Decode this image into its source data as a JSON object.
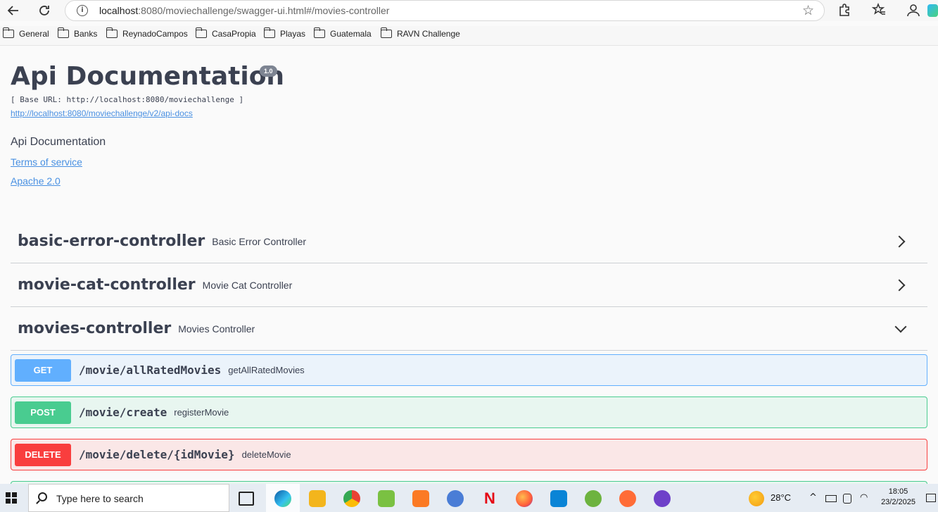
{
  "browser": {
    "url_host": "localhost",
    "url_rest": ":8080/moviechallenge/swagger-ui.html#/movies-controller",
    "back_icon": "back-arrow-icon",
    "reload_icon": "reload-icon"
  },
  "bookmarks": [
    {
      "label": "General"
    },
    {
      "label": "Banks"
    },
    {
      "label": "ReynadoCampos"
    },
    {
      "label": "CasaPropia"
    },
    {
      "label": "Playas"
    },
    {
      "label": "Guatemala"
    },
    {
      "label": "RAVN Challenge"
    }
  ],
  "api": {
    "title": "Api Documentation",
    "version": "1.0",
    "base_url": "[ Base URL: http://localhost:8080/moviechallenge ]",
    "docs_link": "http://localhost:8080/moviechallenge/v2/api-docs",
    "description": "Api Documentation",
    "terms": "Terms of service",
    "license": "Apache 2.0"
  },
  "tags": [
    {
      "name": "basic-error-controller",
      "desc": "Basic Error Controller",
      "expanded": false
    },
    {
      "name": "movie-cat-controller",
      "desc": "Movie Cat Controller",
      "expanded": false
    },
    {
      "name": "movies-controller",
      "desc": "Movies Controller",
      "expanded": true
    }
  ],
  "operations": [
    {
      "method": "GET",
      "path": "/movie/allRatedMovies",
      "summary": "getAllRatedMovies",
      "color": "#61affe",
      "bg": "#ebf3fb"
    },
    {
      "method": "POST",
      "path": "/movie/create",
      "summary": "registerMovie",
      "color": "#49cc90",
      "bg": "#e8f6f0"
    },
    {
      "method": "DELETE",
      "path": "/movie/delete/{idMovie}",
      "summary": "deleteMovie",
      "color": "#f93e3e",
      "bg": "#fae7e7"
    }
  ],
  "taskbar": {
    "search_placeholder": "Type here to search",
    "weather": "28°C",
    "time": "18:05",
    "date": "23/2/2025"
  }
}
